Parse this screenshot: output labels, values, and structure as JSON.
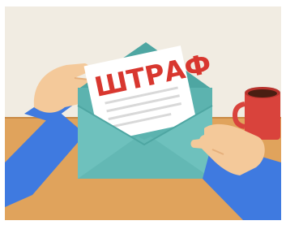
{
  "illustration": {
    "letter_text": "ШТРАФ",
    "colors": {
      "wall": "#f1ece2",
      "table": "#e0a35c",
      "table_edge": "#c98a45",
      "envelope": "#6ec1bd",
      "envelope_dark": "#4ea6a2",
      "paper": "#ffffff",
      "paper_lines": "#d9d9d9",
      "word": "#d8372f",
      "skin": "#f4c99a",
      "skin_shadow": "#e6b07c",
      "sleeve": "#3f7ae0",
      "cup": "#d9433c",
      "coffee": "#4a1e12"
    }
  }
}
